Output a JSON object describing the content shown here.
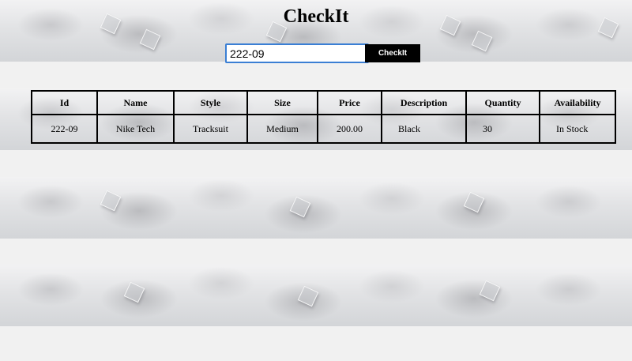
{
  "app": {
    "title": "CheckIt"
  },
  "search": {
    "value": "222-09",
    "button_label": "CheckIt"
  },
  "table": {
    "headers": [
      "Id",
      "Name",
      "Style",
      "Size",
      "Price",
      "Description",
      "Quantity",
      "Availability"
    ],
    "rows": [
      [
        "222-09",
        "Nike Tech",
        "Tracksuit",
        "Medium",
        "200.00",
        "Black",
        "30",
        "In Stock"
      ]
    ]
  }
}
